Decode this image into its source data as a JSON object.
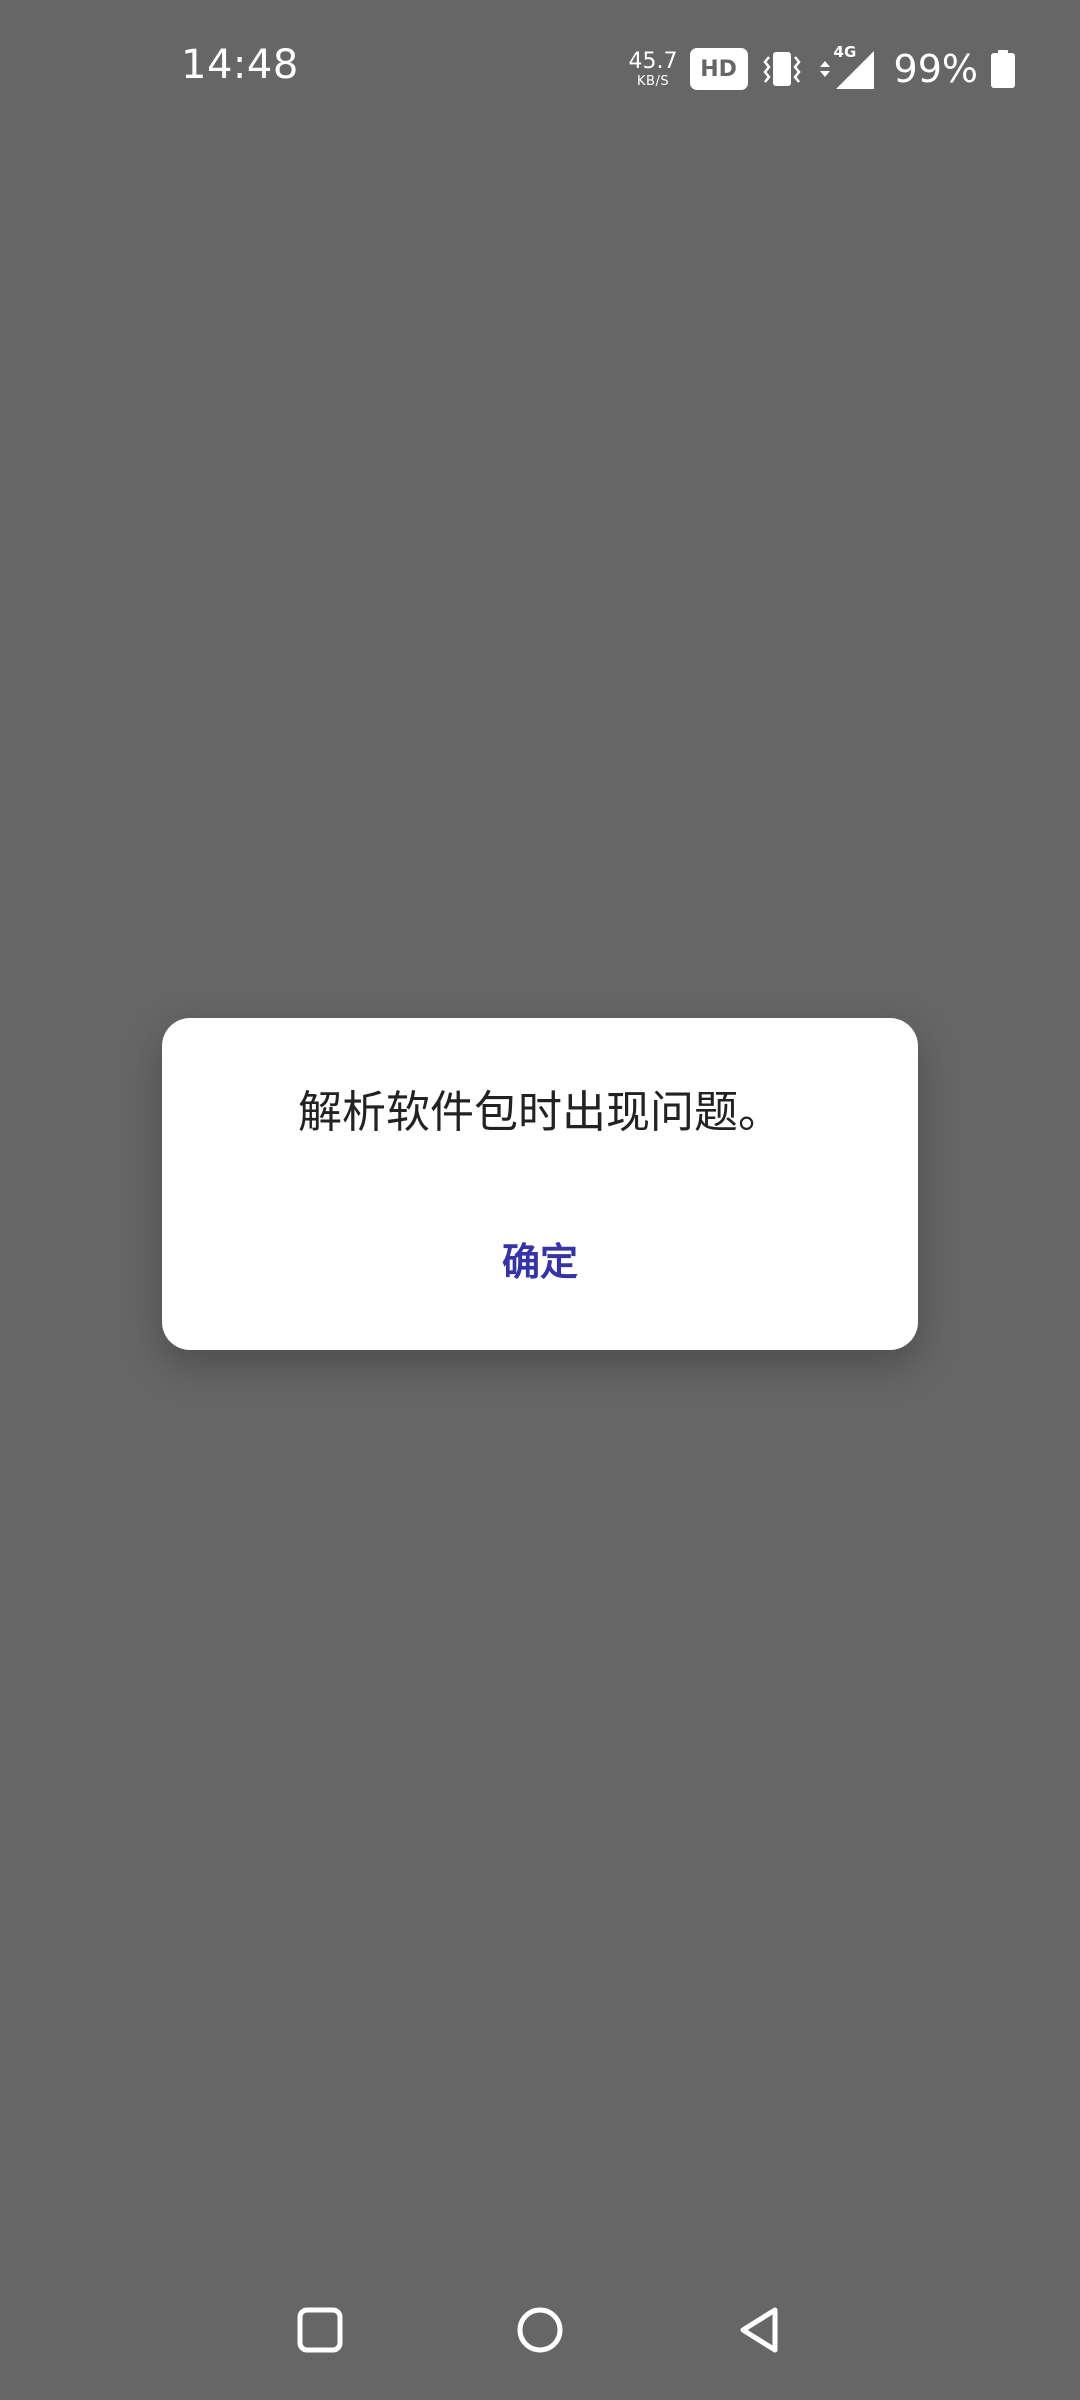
{
  "status_bar": {
    "time": "14:48",
    "net_speed_value": "45.7",
    "net_speed_unit": "KB/S",
    "hd_label": "HD",
    "network_label": "4G",
    "battery_percent": "99%",
    "icons": [
      "vibrate-icon",
      "data-arrows-icon",
      "signal-icon",
      "battery-icon"
    ]
  },
  "dialog": {
    "message": "解析软件包时出现问题。",
    "ok_label": "确定",
    "ok_color": "#3633A6"
  },
  "nav_bar": {
    "icons": [
      "recents-icon",
      "home-icon",
      "back-icon"
    ]
  },
  "colors": {
    "scrim": "#666666",
    "dialog_bg": "#ffffff",
    "text": "#222222"
  }
}
